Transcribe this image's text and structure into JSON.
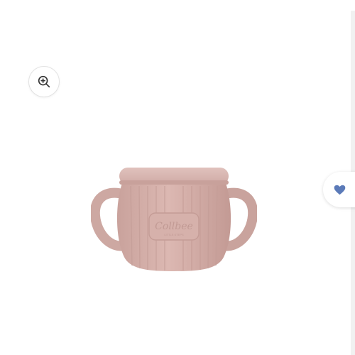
{
  "zoom_button": {
    "icon": "zoom-in-icon"
  },
  "wishlist_button": {
    "icon": "heart-icon",
    "color": "#5b7ab8"
  },
  "product": {
    "color": "#d9b3ad",
    "logo_text": "Collbee",
    "logo_subtext": "LITTLE STEPS"
  }
}
